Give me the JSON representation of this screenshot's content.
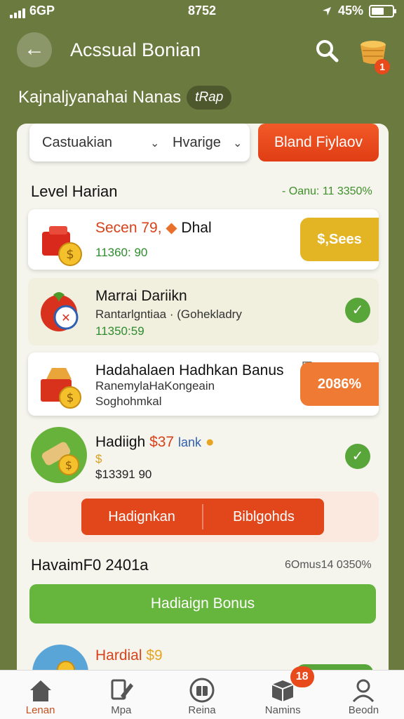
{
  "status": {
    "signal": "6GP",
    "time": "8752",
    "battery": "45%"
  },
  "header": {
    "title": "Acssual Bonian",
    "cart_count": "1"
  },
  "subtitle": {
    "text": "Kajnaljyanahai Nanas",
    "chip": "tRap"
  },
  "filters": {
    "filter1": "Castuakian",
    "filter2": "Hvarige",
    "action_label": "Bland Fiylaov"
  },
  "level_section": {
    "title": "Level Harian",
    "meta": "- Oanu: 11 3350%"
  },
  "items": [
    {
      "title": "Secen 79,",
      "title_suffix": "Dhal",
      "price": "11360: 90",
      "badge": "$,Sees",
      "badge_color": "#e3b424"
    },
    {
      "title": "Marrai Dariikn",
      "line1": "Rantarlgntiaa · (Gohekladry",
      "price": "11350:59"
    },
    {
      "title": "Hadahalaen Hadhkan Banus",
      "line1": "RanemylaHaKongeain",
      "line2": "Soghohmkal",
      "badge": "2086%",
      "badge_color": "#ee7a33"
    },
    {
      "title": "Hadiigh",
      "title_hl": "$37",
      "title_suffix": "lank",
      "line1": "$",
      "price": "$13391 90"
    }
  ],
  "claim": {
    "left": "Hadignkan",
    "right": "Biblgohds"
  },
  "section2": {
    "title": "HavaimF0 2401a",
    "meta": "6Omus14 0350%"
  },
  "green_button": "Hadiaign Bonus",
  "last_item": {
    "title": "Hardial",
    "title_hl": "$9"
  },
  "nav": [
    {
      "label": "Lenan"
    },
    {
      "label": "Mpa"
    },
    {
      "label": "Reina"
    },
    {
      "label": "Namins",
      "badge": "18"
    },
    {
      "label": "Beodn"
    }
  ]
}
